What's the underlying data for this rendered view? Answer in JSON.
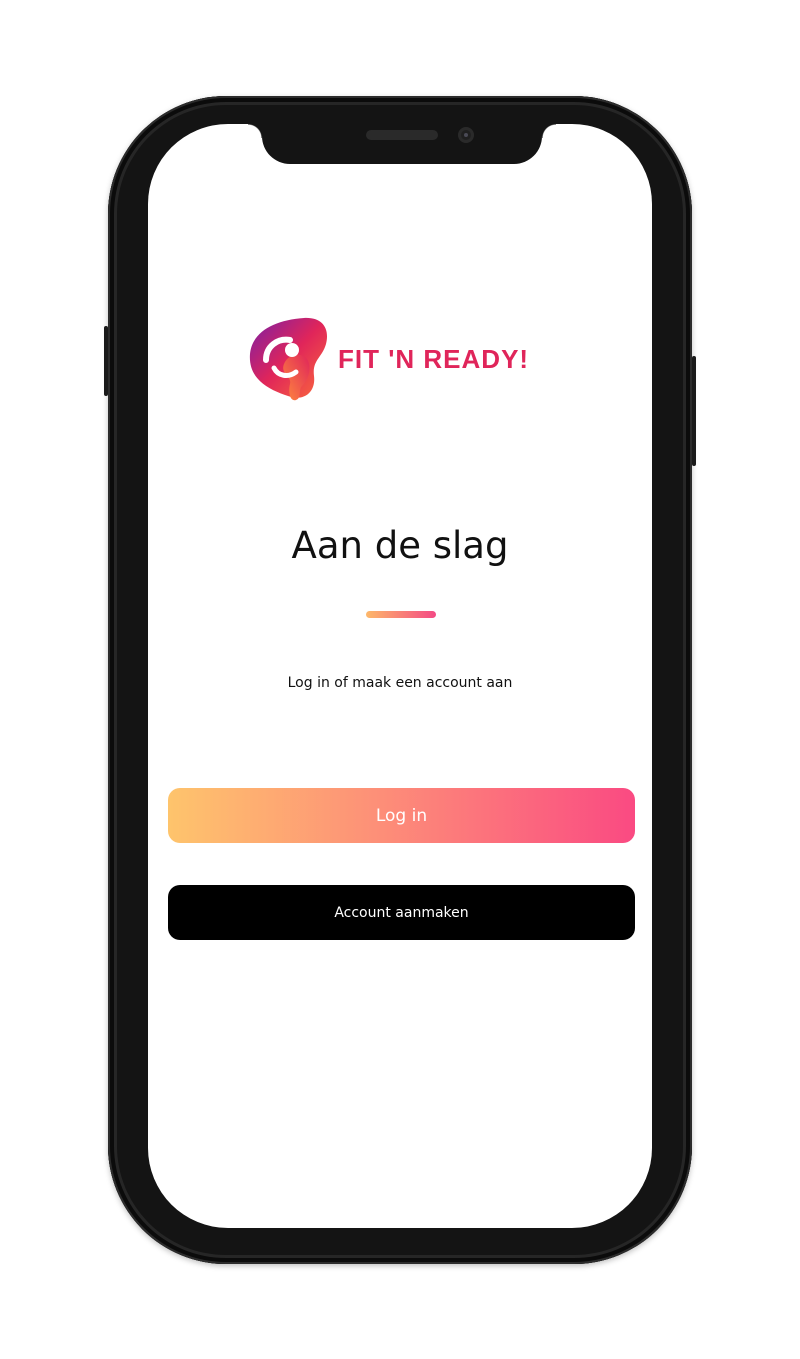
{
  "brand": {
    "name": "FIT 'N READY!",
    "color": "#e0255a"
  },
  "welcome": {
    "title": "Aan de slag",
    "subtitle": "Log in of maak een account aan"
  },
  "actions": {
    "login_label": "Log in",
    "signup_label": "Account aanmaken"
  },
  "colors": {
    "gradient_start": "#fec46c",
    "gradient_end": "#fa4a82",
    "signup_bg": "#000000"
  }
}
